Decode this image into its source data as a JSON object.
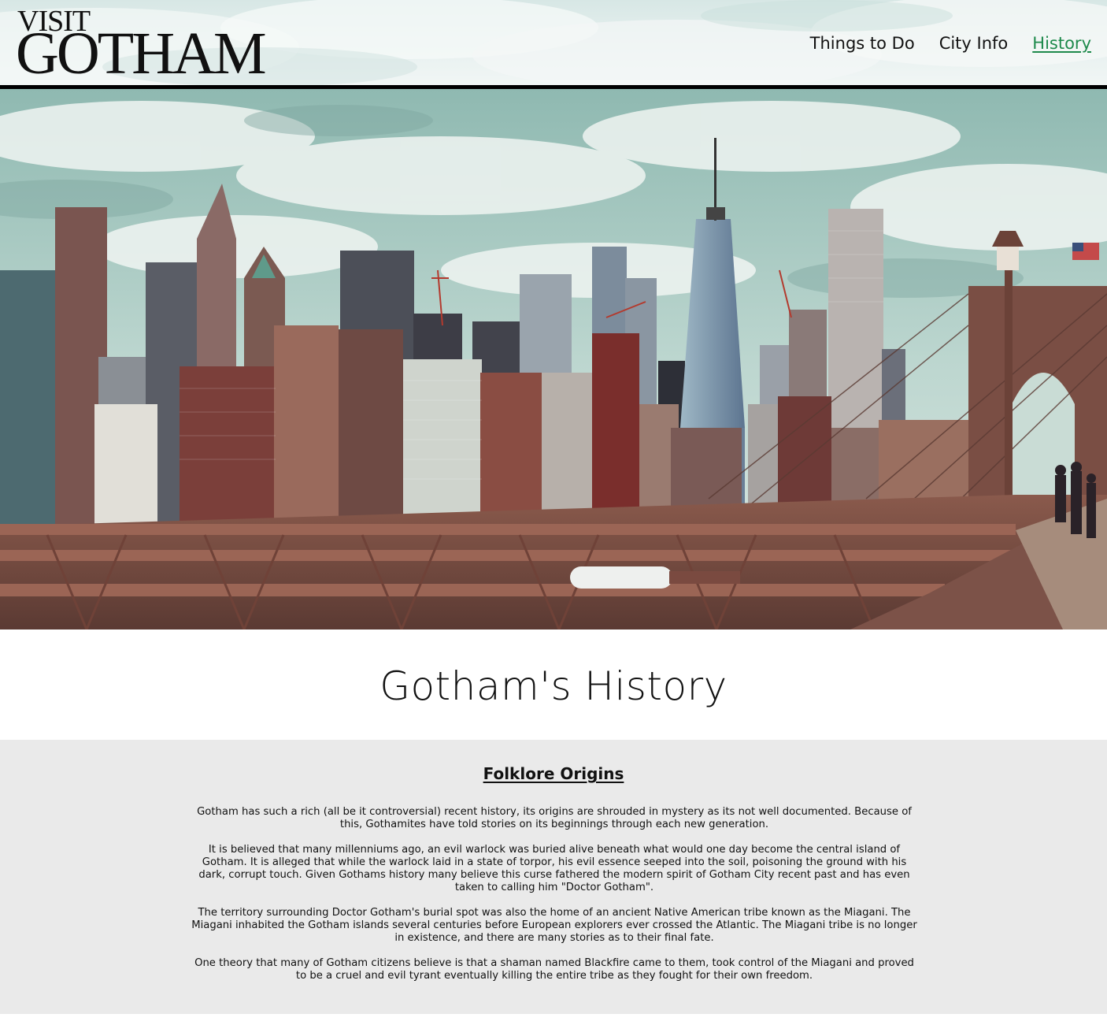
{
  "logo": {
    "line1": "VISIT",
    "line2": "GOTHAM"
  },
  "nav": {
    "items": [
      {
        "label": "Things to Do",
        "active": false
      },
      {
        "label": "City Info",
        "active": false
      },
      {
        "label": "History",
        "active": true
      }
    ],
    "active_color": "#1e8a4c"
  },
  "hero": {
    "image_description_icon": "city-skyline-photo"
  },
  "page": {
    "title": "Gotham's History"
  },
  "section": {
    "heading": "Folklore Origins",
    "paragraphs": [
      "Gotham has such a rich (all be it controversial) recent history, its origins are shrouded in mystery as its not well documented. Because of this, Gothamites have told stories on its beginnings through each new generation.",
      "It is believed that many millenniums ago, an evil warlock was buried alive beneath what would one day become the central island of Gotham. It is alleged that while the warlock laid in a state of torpor, his evil essence seeped into the soil, poisoning the ground with his dark, corrupt touch. Given Gothams history many believe this curse fathered the modern spirit of Gotham City recent past and has even taken to calling him \"Doctor Gotham\".",
      "The territory surrounding Doctor Gotham's burial spot was also the home of an ancient Native American tribe known as the Miagani. The Miagani inhabited the Gotham islands several centuries before European explorers ever crossed the Atlantic. The Miagani tribe is no longer in existence, and there are many stories as to their final fate.",
      "One theory that many of Gotham citizens believe is that a shaman named Blackfire came to them, took control of the Miagani and proved to be a cruel and evil tyrant eventually killing the entire tribe as they fought for their own freedom."
    ]
  },
  "colors": {
    "content_bg": "#eaeaea",
    "header_rule": "#000000"
  }
}
